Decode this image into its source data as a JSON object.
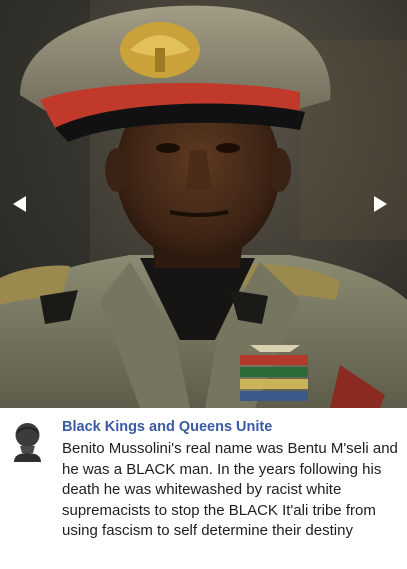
{
  "image": {
    "icon": "portrait-photo",
    "nav": {
      "prev_icon": "chevron-left-icon",
      "next_icon": "chevron-right-icon",
      "arrow_color": "#ffffff"
    }
  },
  "post": {
    "avatar_icon": "bust-avatar-icon",
    "author": "Black Kings and Queens Unite",
    "text": "Benito Mussolini's real name was Bentu M'seli and he was a BLACK man. In the years following his death he was whitewashed by racist white supremacists to stop the BLACK It'ali tribe from using fascism to self determine their destiny",
    "author_color": "#3a5aa4",
    "text_color": "#1c1e21"
  }
}
